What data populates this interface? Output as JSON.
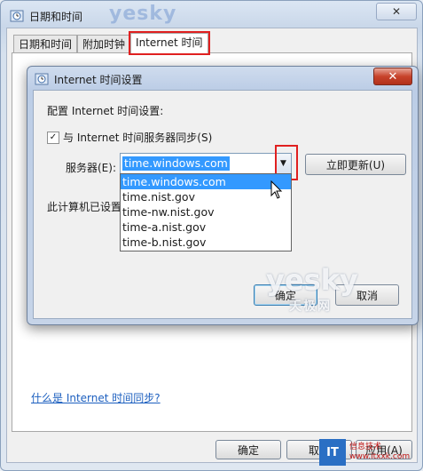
{
  "outer": {
    "title": "日期和时间",
    "watermark": "yesky",
    "close": "✕",
    "tabs": [
      "日期和时间",
      "附加时钟",
      "Internet 时间"
    ],
    "help_link": "什么是 Internet 时间同步?",
    "buttons": {
      "ok": "确定",
      "cancel": "取消",
      "apply": "应用(A)"
    }
  },
  "inner": {
    "title": "Internet 时间设置",
    "close": "✕",
    "config_label": "配置 Internet 时间设置:",
    "sync_checkbox_label": "与 Internet 时间服务器同步(S)",
    "sync_checked": true,
    "server_label": "服务器(E):",
    "server_value": "time.windows.com",
    "update_button": "立即更新(U)",
    "sync_status": "此计算机已设置",
    "server_options": [
      "time.windows.com",
      "time.nist.gov",
      "time-nw.nist.gov",
      "time-a.nist.gov",
      "time-b.nist.gov"
    ],
    "selected_index": 0,
    "ok_button": "确定",
    "cancel_button": "取消"
  },
  "watermarks": {
    "mid": "yesky",
    "mid_cn": "天极网",
    "bottom_right_logo": "IT",
    "bottom_right_text1": "信息技术",
    "bottom_right_text2": "www.itxxk.com"
  }
}
